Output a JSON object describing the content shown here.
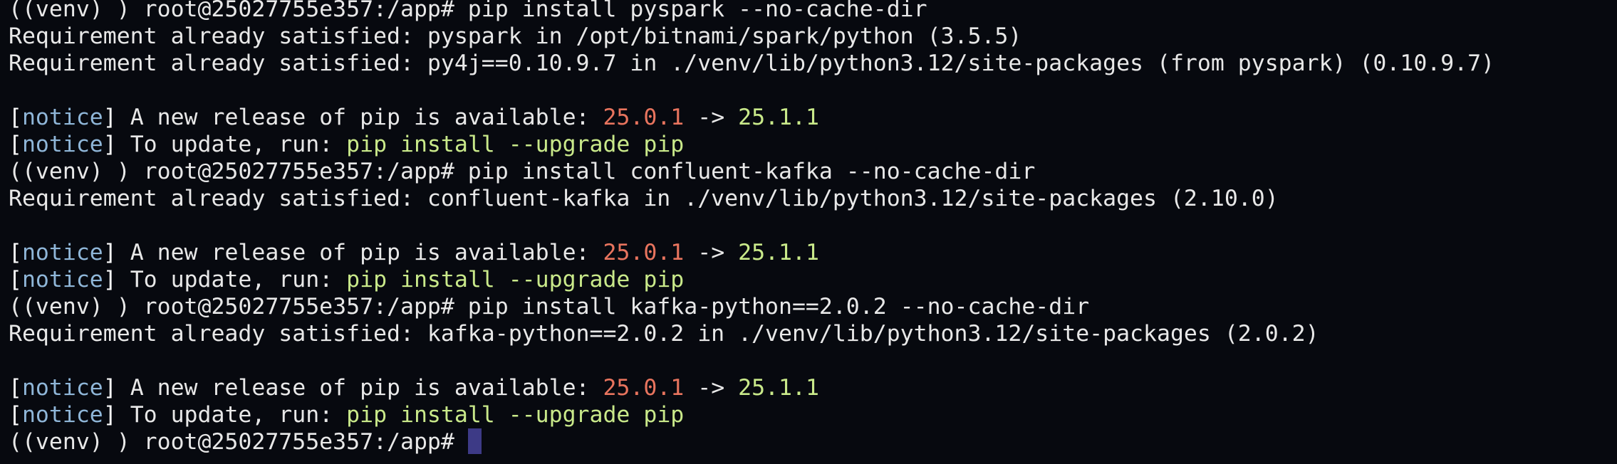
{
  "colors": {
    "background": "#07090f",
    "text": "#e8e8e8",
    "notice_tag": "#8fb6d8",
    "old_version": "#e8745e",
    "new_version": "#c9e98a",
    "cursor": "#3d3a86"
  },
  "terminal": {
    "prompt": "((venv) ) root@25027755e357:/app# ",
    "blocks": [
      {
        "command": "pip install pyspark --no-cache-dir",
        "output": [
          "Requirement already satisfied: pyspark in /opt/bitnami/spark/python (3.5.5)",
          "Requirement already satisfied: py4j==0.10.9.7 in ./venv/lib/python3.12/site-packages (from pyspark) (0.10.9.7)"
        ]
      },
      {
        "command": "pip install confluent-kafka --no-cache-dir",
        "output": [
          "Requirement already satisfied: confluent-kafka in ./venv/lib/python3.12/site-packages (2.10.0)"
        ]
      },
      {
        "command": "pip install kafka-python==2.0.2 --no-cache-dir",
        "output": [
          "Requirement already satisfied: kafka-python==2.0.2 in ./venv/lib/python3.12/site-packages (2.0.2)"
        ]
      }
    ],
    "notice": {
      "bracket_open": "[",
      "tag": "notice",
      "bracket_close": "]",
      "release_text": " A new release of pip is available: ",
      "old_version": "25.0.1",
      "arrow": " -> ",
      "new_version": "25.1.1",
      "update_text": " To update, run: ",
      "update_command": "pip install --upgrade pip"
    }
  }
}
